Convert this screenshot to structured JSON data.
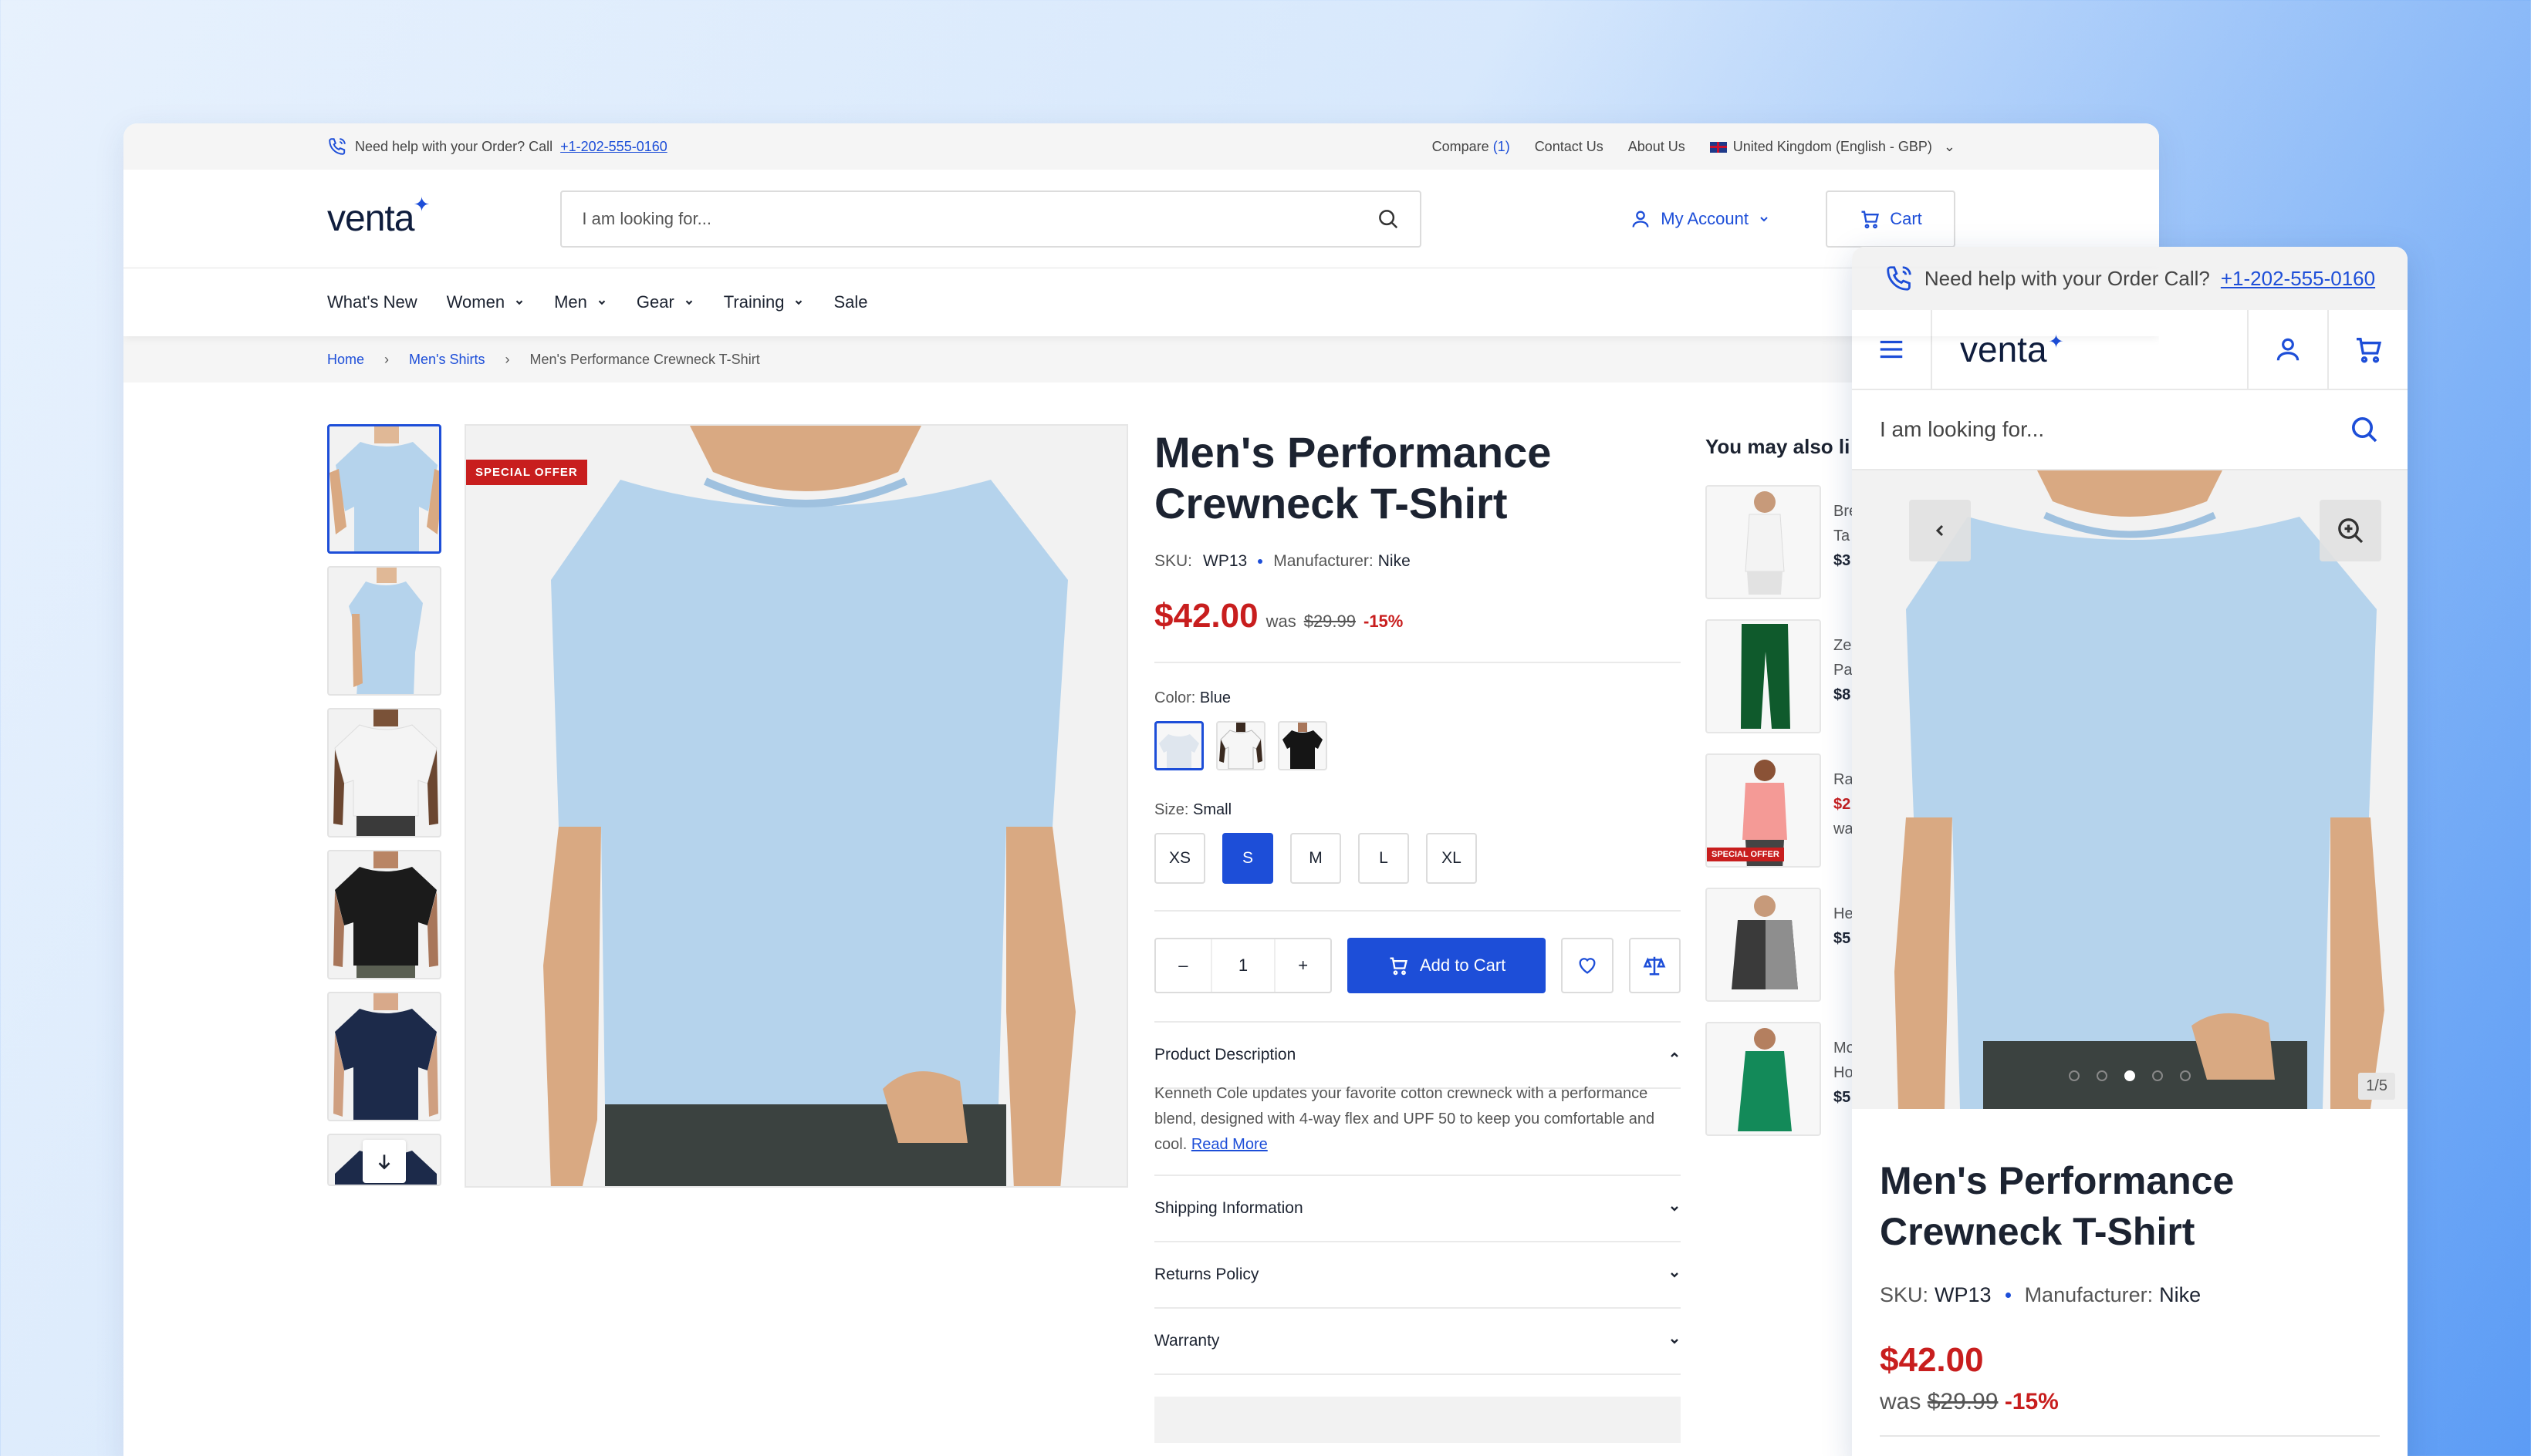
{
  "desktop": {
    "topbar": {
      "help_text": "Need help with your Order? Call",
      "phone": "+1-202-555-0160",
      "compare_label": "Compare",
      "compare_count": "(1)",
      "contact": "Contact Us",
      "about": "About Us",
      "region": "United Kingdom (English - GBP)"
    },
    "header": {
      "logo": "venta",
      "search_placeholder": "I am looking for...",
      "account": "My Account",
      "cart": "Cart"
    },
    "nav": [
      {
        "label": "What's New",
        "dropdown": false
      },
      {
        "label": "Women",
        "dropdown": true
      },
      {
        "label": "Men",
        "dropdown": true
      },
      {
        "label": "Gear",
        "dropdown": true
      },
      {
        "label": "Training",
        "dropdown": true
      },
      {
        "label": "Sale",
        "dropdown": false
      }
    ],
    "breadcrumb": [
      "Home",
      "Men's Shirts",
      "Men's Performance Crewneck T-Shirt"
    ],
    "badge": "SPECIAL OFFER",
    "product": {
      "title": "Men's Performance Crewneck T-Shirt",
      "sku_label": "SKU:",
      "sku": "WP13",
      "manufacturer_label": "Manufacturer:",
      "manufacturer": "Nike",
      "price": "$42.00",
      "was_label": "was",
      "was_price": "$29.99",
      "discount": "-15%",
      "color_label": "Color:",
      "color_value": "Blue",
      "size_label": "Size:",
      "size_value": "Small",
      "sizes": [
        "XS",
        "S",
        "M",
        "L",
        "XL"
      ],
      "selected_size": "S",
      "quantity": "1",
      "qty_minus": "–",
      "qty_plus": "+",
      "add_to_cart": "Add to Cart",
      "description_title": "Product Description",
      "description": "Kenneth Cole updates your favorite cotton crewneck with a performance blend, designed with 4-way flex and UPF 50 to keep you comfortable and cool.",
      "read_more": "Read More",
      "accordions": [
        "Shipping Information",
        "Returns Policy",
        "Warranty"
      ]
    },
    "also": {
      "heading": "You may also li",
      "items": [
        {
          "line1": "Bre",
          "line2": "Ta",
          "price": "$3",
          "red": false
        },
        {
          "line1": "Ze",
          "line2": "Pa",
          "price": "$8",
          "red": false
        },
        {
          "line1": "Ra",
          "line2": "$2",
          "price": "wa",
          "red": true,
          "badge": "SPECIAL OFFER"
        },
        {
          "line1": "He",
          "line2": "$5",
          "price": "",
          "red": false
        },
        {
          "line1": "Mo",
          "line2": "Ho",
          "price": "$5",
          "red": false
        }
      ]
    }
  },
  "mobile": {
    "help_text": "Need help with your Order Call?",
    "phone": "+1-202-555-0160",
    "logo": "venta",
    "search_placeholder": "I am looking for...",
    "counter": "1/5",
    "title": "Men's Performance Crewneck T-Shirt",
    "sku_label": "SKU:",
    "sku": "WP13",
    "manufacturer_label": "Manufacturer:",
    "manufacturer": "Nike",
    "price": "$42.00",
    "was_label": "was",
    "was_price": "$29.99",
    "discount": "-15%"
  },
  "colors": {
    "accent": "#1d4ed8",
    "sale": "#c81e1e",
    "shirt_blue": "#b5d3ec"
  }
}
